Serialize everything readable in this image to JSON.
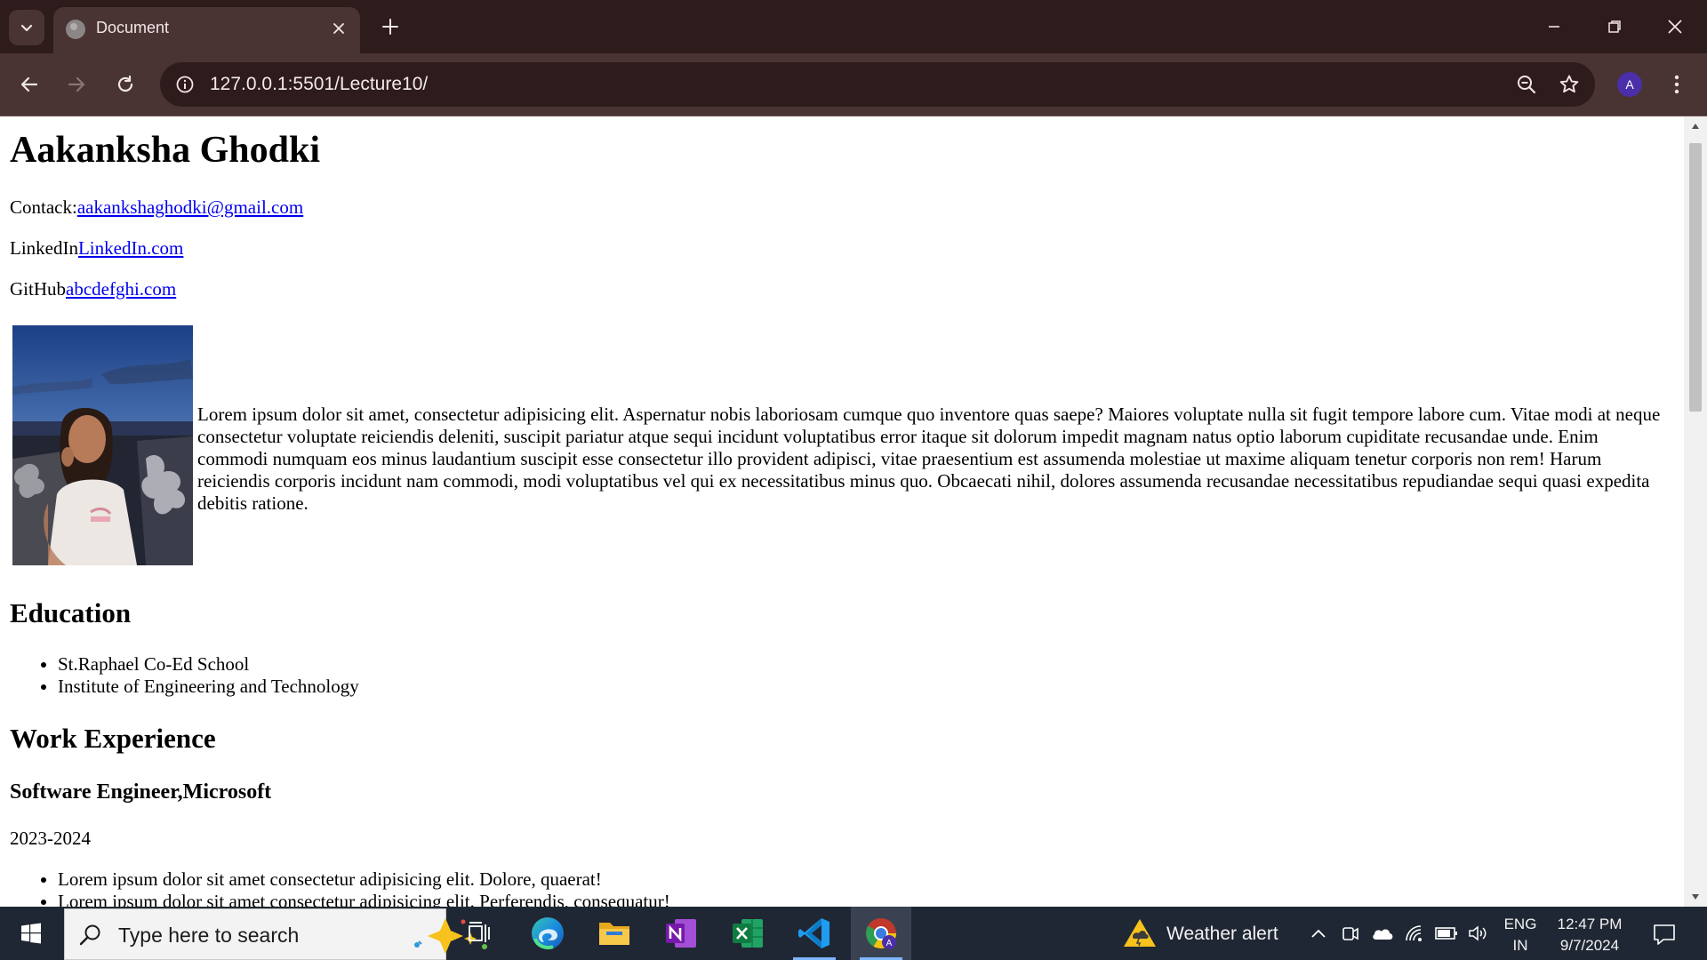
{
  "browser": {
    "tab_title": "Document",
    "url": "127.0.0.1:5501/Lecture10/",
    "profile_initial": "A"
  },
  "page": {
    "name": "Aakanksha Ghodki",
    "contact_label": "Contack:",
    "contact_email": "aakankshaghodki@gmail.com",
    "linkedin_label": "LinkedIn",
    "linkedin_link": "LinkedIn.com",
    "github_label": "GitHub",
    "github_link": "abcdefghi.com",
    "intro": "Lorem ipsum dolor sit amet, consectetur adipisicing elit. Aspernatur nobis laboriosam cumque quo inventore quas saepe? Maiores voluptate nulla sit fugit tempore labore cum. Vitae modi at neque consectetur voluptate reiciendis deleniti, suscipit pariatur atque sequi incidunt voluptatibus error itaque sit dolorum impedit magnam natus optio laborum cupiditate recusandae unde. Enim commodi numquam eos minus laudantium suscipit esse consectetur illo provident adipisci, vitae praesentium est assumenda molestiae ut maxime aliquam tenetur corporis non rem! Harum reiciendis corporis incidunt nam commodi, modi voluptatibus vel qui ex necessitatibus minus quo. Obcaecati nihil, dolores assumenda recusandae necessitatibus repudiandae sequi quasi expedita debitis ratione.",
    "education_heading": "Education",
    "education": [
      "St.Raphael Co-Ed School",
      "Institute of Engineering and Technology"
    ],
    "work_heading": "Work Experience",
    "job_title": "Software Engineer,Microsoft",
    "job_years": "2023-2024",
    "job_bullets": [
      "Lorem ipsum dolor sit amet consectetur adipisicing elit. Dolore, quaerat!",
      "Lorem ipsum dolor sit amet consectetur adipisicing elit. Perferendis, consequatur!"
    ]
  },
  "taskbar": {
    "search_placeholder": "Type here to search",
    "weather_label": "Weather alert",
    "lang_line1": "ENG",
    "lang_line2": "IN",
    "time": "12:47 PM",
    "date": "9/7/2024"
  }
}
